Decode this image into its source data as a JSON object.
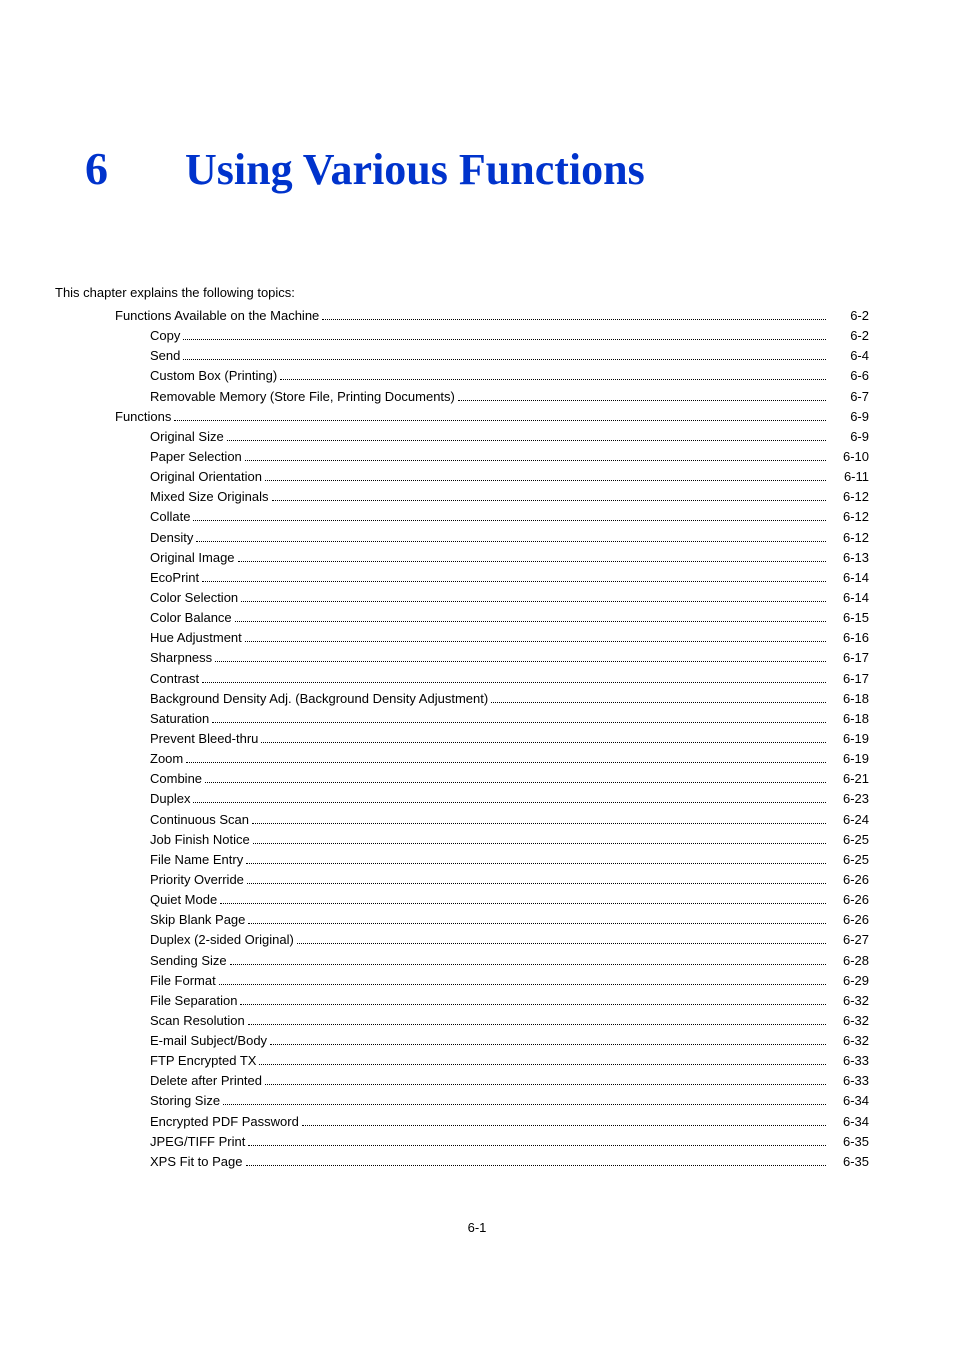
{
  "chapter_number": "6",
  "chapter_title": "Using Various Functions",
  "intro_text": "This chapter explains the following topics:",
  "page_number": "6-1",
  "toc": [
    {
      "level": 1,
      "label": "Functions Available on the Machine",
      "page": "6-2"
    },
    {
      "level": 2,
      "label": "Copy",
      "page": "6-2"
    },
    {
      "level": 2,
      "label": "Send",
      "page": "6-4"
    },
    {
      "level": 2,
      "label": "Custom Box (Printing)",
      "page": "6-6"
    },
    {
      "level": 2,
      "label": "Removable Memory (Store File, Printing Documents)",
      "page": "6-7"
    },
    {
      "level": 1,
      "label": "Functions",
      "page": "6-9"
    },
    {
      "level": 2,
      "label": "Original Size",
      "page": "6-9"
    },
    {
      "level": 2,
      "label": "Paper Selection",
      "page": "6-10"
    },
    {
      "level": 2,
      "label": "Original Orientation",
      "page": "6-11"
    },
    {
      "level": 2,
      "label": "Mixed Size Originals",
      "page": "6-12"
    },
    {
      "level": 2,
      "label": "Collate",
      "page": "6-12"
    },
    {
      "level": 2,
      "label": "Density",
      "page": "6-12"
    },
    {
      "level": 2,
      "label": "Original Image",
      "page": "6-13"
    },
    {
      "level": 2,
      "label": "EcoPrint",
      "page": "6-14"
    },
    {
      "level": 2,
      "label": "Color Selection",
      "page": "6-14"
    },
    {
      "level": 2,
      "label": "Color Balance",
      "page": "6-15"
    },
    {
      "level": 2,
      "label": "Hue Adjustment",
      "page": "6-16"
    },
    {
      "level": 2,
      "label": "Sharpness",
      "page": "6-17"
    },
    {
      "level": 2,
      "label": "Contrast",
      "page": "6-17"
    },
    {
      "level": 2,
      "label": "Background Density Adj. (Background Density Adjustment)",
      "page": "6-18"
    },
    {
      "level": 2,
      "label": "Saturation",
      "page": "6-18"
    },
    {
      "level": 2,
      "label": "Prevent Bleed-thru",
      "page": "6-19"
    },
    {
      "level": 2,
      "label": "Zoom",
      "page": "6-19"
    },
    {
      "level": 2,
      "label": "Combine",
      "page": "6-21"
    },
    {
      "level": 2,
      "label": "Duplex",
      "page": "6-23"
    },
    {
      "level": 2,
      "label": "Continuous Scan",
      "page": "6-24"
    },
    {
      "level": 2,
      "label": "Job Finish Notice",
      "page": "6-25"
    },
    {
      "level": 2,
      "label": "File Name Entry",
      "page": "6-25"
    },
    {
      "level": 2,
      "label": "Priority Override",
      "page": "6-26"
    },
    {
      "level": 2,
      "label": "Quiet Mode",
      "page": "6-26"
    },
    {
      "level": 2,
      "label": "Skip Blank Page",
      "page": "6-26"
    },
    {
      "level": 2,
      "label": "Duplex (2-sided Original)",
      "page": "6-27"
    },
    {
      "level": 2,
      "label": "Sending Size",
      "page": "6-28"
    },
    {
      "level": 2,
      "label": "File Format",
      "page": "6-29"
    },
    {
      "level": 2,
      "label": "File Separation",
      "page": "6-32"
    },
    {
      "level": 2,
      "label": "Scan Resolution",
      "page": "6-32"
    },
    {
      "level": 2,
      "label": "E-mail Subject/Body",
      "page": "6-32"
    },
    {
      "level": 2,
      "label": "FTP Encrypted TX",
      "page": "6-33"
    },
    {
      "level": 2,
      "label": "Delete after Printed",
      "page": "6-33"
    },
    {
      "level": 2,
      "label": "Storing Size",
      "page": "6-34"
    },
    {
      "level": 2,
      "label": "Encrypted PDF Password",
      "page": "6-34"
    },
    {
      "level": 2,
      "label": "JPEG/TIFF Print",
      "page": "6-35"
    },
    {
      "level": 2,
      "label": "XPS Fit to Page",
      "page": "6-35"
    }
  ]
}
